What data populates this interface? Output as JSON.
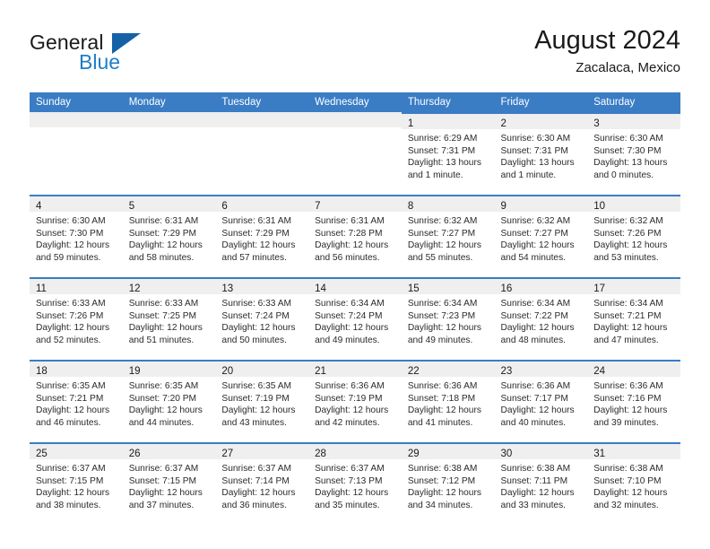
{
  "brand": {
    "line1": "General",
    "line2": "Blue",
    "logo_icon": "triangle-flag-icon"
  },
  "header": {
    "title": "August 2024",
    "subtitle": "Zacalaca, Mexico"
  },
  "calendar": {
    "weekday_headers": [
      "Sunday",
      "Monday",
      "Tuesday",
      "Wednesday",
      "Thursday",
      "Friday",
      "Saturday"
    ],
    "accent_color": "#3a7dc4",
    "daynum_strip_color": "#efefef",
    "weeks": [
      [
        {
          "empty": true
        },
        {
          "empty": true
        },
        {
          "empty": true
        },
        {
          "empty": true
        },
        {
          "day": "1",
          "sunrise": "Sunrise: 6:29 AM",
          "sunset": "Sunset: 7:31 PM",
          "daylight1": "Daylight: 13 hours",
          "daylight2": "and 1 minute."
        },
        {
          "day": "2",
          "sunrise": "Sunrise: 6:30 AM",
          "sunset": "Sunset: 7:31 PM",
          "daylight1": "Daylight: 13 hours",
          "daylight2": "and 1 minute."
        },
        {
          "day": "3",
          "sunrise": "Sunrise: 6:30 AM",
          "sunset": "Sunset: 7:30 PM",
          "daylight1": "Daylight: 13 hours",
          "daylight2": "and 0 minutes."
        }
      ],
      [
        {
          "day": "4",
          "sunrise": "Sunrise: 6:30 AM",
          "sunset": "Sunset: 7:30 PM",
          "daylight1": "Daylight: 12 hours",
          "daylight2": "and 59 minutes."
        },
        {
          "day": "5",
          "sunrise": "Sunrise: 6:31 AM",
          "sunset": "Sunset: 7:29 PM",
          "daylight1": "Daylight: 12 hours",
          "daylight2": "and 58 minutes."
        },
        {
          "day": "6",
          "sunrise": "Sunrise: 6:31 AM",
          "sunset": "Sunset: 7:29 PM",
          "daylight1": "Daylight: 12 hours",
          "daylight2": "and 57 minutes."
        },
        {
          "day": "7",
          "sunrise": "Sunrise: 6:31 AM",
          "sunset": "Sunset: 7:28 PM",
          "daylight1": "Daylight: 12 hours",
          "daylight2": "and 56 minutes."
        },
        {
          "day": "8",
          "sunrise": "Sunrise: 6:32 AM",
          "sunset": "Sunset: 7:27 PM",
          "daylight1": "Daylight: 12 hours",
          "daylight2": "and 55 minutes."
        },
        {
          "day": "9",
          "sunrise": "Sunrise: 6:32 AM",
          "sunset": "Sunset: 7:27 PM",
          "daylight1": "Daylight: 12 hours",
          "daylight2": "and 54 minutes."
        },
        {
          "day": "10",
          "sunrise": "Sunrise: 6:32 AM",
          "sunset": "Sunset: 7:26 PM",
          "daylight1": "Daylight: 12 hours",
          "daylight2": "and 53 minutes."
        }
      ],
      [
        {
          "day": "11",
          "sunrise": "Sunrise: 6:33 AM",
          "sunset": "Sunset: 7:26 PM",
          "daylight1": "Daylight: 12 hours",
          "daylight2": "and 52 minutes."
        },
        {
          "day": "12",
          "sunrise": "Sunrise: 6:33 AM",
          "sunset": "Sunset: 7:25 PM",
          "daylight1": "Daylight: 12 hours",
          "daylight2": "and 51 minutes."
        },
        {
          "day": "13",
          "sunrise": "Sunrise: 6:33 AM",
          "sunset": "Sunset: 7:24 PM",
          "daylight1": "Daylight: 12 hours",
          "daylight2": "and 50 minutes."
        },
        {
          "day": "14",
          "sunrise": "Sunrise: 6:34 AM",
          "sunset": "Sunset: 7:24 PM",
          "daylight1": "Daylight: 12 hours",
          "daylight2": "and 49 minutes."
        },
        {
          "day": "15",
          "sunrise": "Sunrise: 6:34 AM",
          "sunset": "Sunset: 7:23 PM",
          "daylight1": "Daylight: 12 hours",
          "daylight2": "and 49 minutes."
        },
        {
          "day": "16",
          "sunrise": "Sunrise: 6:34 AM",
          "sunset": "Sunset: 7:22 PM",
          "daylight1": "Daylight: 12 hours",
          "daylight2": "and 48 minutes."
        },
        {
          "day": "17",
          "sunrise": "Sunrise: 6:34 AM",
          "sunset": "Sunset: 7:21 PM",
          "daylight1": "Daylight: 12 hours",
          "daylight2": "and 47 minutes."
        }
      ],
      [
        {
          "day": "18",
          "sunrise": "Sunrise: 6:35 AM",
          "sunset": "Sunset: 7:21 PM",
          "daylight1": "Daylight: 12 hours",
          "daylight2": "and 46 minutes."
        },
        {
          "day": "19",
          "sunrise": "Sunrise: 6:35 AM",
          "sunset": "Sunset: 7:20 PM",
          "daylight1": "Daylight: 12 hours",
          "daylight2": "and 44 minutes."
        },
        {
          "day": "20",
          "sunrise": "Sunrise: 6:35 AM",
          "sunset": "Sunset: 7:19 PM",
          "daylight1": "Daylight: 12 hours",
          "daylight2": "and 43 minutes."
        },
        {
          "day": "21",
          "sunrise": "Sunrise: 6:36 AM",
          "sunset": "Sunset: 7:19 PM",
          "daylight1": "Daylight: 12 hours",
          "daylight2": "and 42 minutes."
        },
        {
          "day": "22",
          "sunrise": "Sunrise: 6:36 AM",
          "sunset": "Sunset: 7:18 PM",
          "daylight1": "Daylight: 12 hours",
          "daylight2": "and 41 minutes."
        },
        {
          "day": "23",
          "sunrise": "Sunrise: 6:36 AM",
          "sunset": "Sunset: 7:17 PM",
          "daylight1": "Daylight: 12 hours",
          "daylight2": "and 40 minutes."
        },
        {
          "day": "24",
          "sunrise": "Sunrise: 6:36 AM",
          "sunset": "Sunset: 7:16 PM",
          "daylight1": "Daylight: 12 hours",
          "daylight2": "and 39 minutes."
        }
      ],
      [
        {
          "day": "25",
          "sunrise": "Sunrise: 6:37 AM",
          "sunset": "Sunset: 7:15 PM",
          "daylight1": "Daylight: 12 hours",
          "daylight2": "and 38 minutes."
        },
        {
          "day": "26",
          "sunrise": "Sunrise: 6:37 AM",
          "sunset": "Sunset: 7:15 PM",
          "daylight1": "Daylight: 12 hours",
          "daylight2": "and 37 minutes."
        },
        {
          "day": "27",
          "sunrise": "Sunrise: 6:37 AM",
          "sunset": "Sunset: 7:14 PM",
          "daylight1": "Daylight: 12 hours",
          "daylight2": "and 36 minutes."
        },
        {
          "day": "28",
          "sunrise": "Sunrise: 6:37 AM",
          "sunset": "Sunset: 7:13 PM",
          "daylight1": "Daylight: 12 hours",
          "daylight2": "and 35 minutes."
        },
        {
          "day": "29",
          "sunrise": "Sunrise: 6:38 AM",
          "sunset": "Sunset: 7:12 PM",
          "daylight1": "Daylight: 12 hours",
          "daylight2": "and 34 minutes."
        },
        {
          "day": "30",
          "sunrise": "Sunrise: 6:38 AM",
          "sunset": "Sunset: 7:11 PM",
          "daylight1": "Daylight: 12 hours",
          "daylight2": "and 33 minutes."
        },
        {
          "day": "31",
          "sunrise": "Sunrise: 6:38 AM",
          "sunset": "Sunset: 7:10 PM",
          "daylight1": "Daylight: 12 hours",
          "daylight2": "and 32 minutes."
        }
      ]
    ]
  }
}
